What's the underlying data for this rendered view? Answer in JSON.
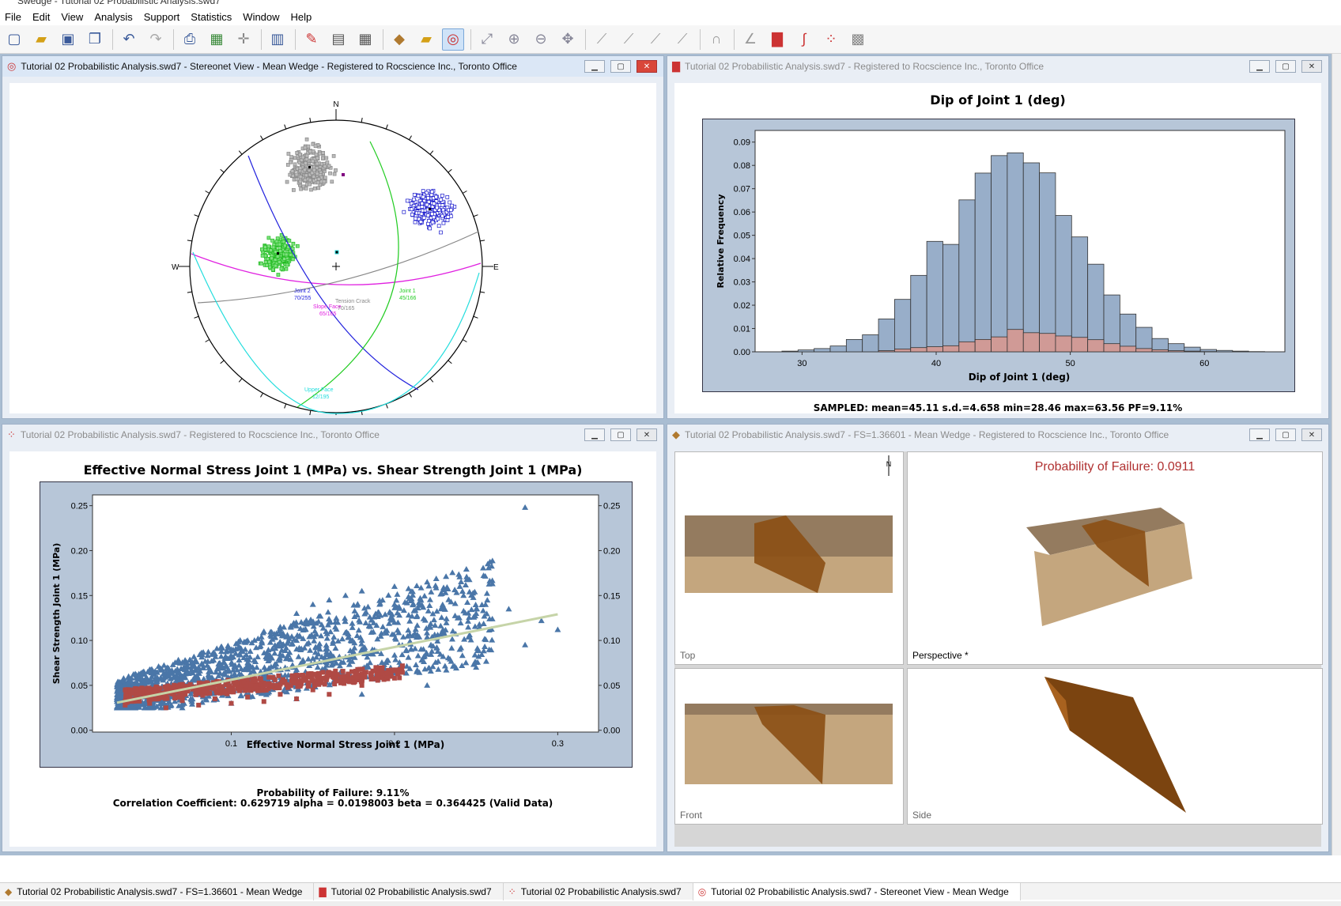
{
  "app": {
    "title": "Swedge - Tutorial 02 Probabilistic Analysis.swd7"
  },
  "menu": [
    "File",
    "Edit",
    "View",
    "Analysis",
    "Support",
    "Statistics",
    "Window",
    "Help"
  ],
  "toolbar_icons": [
    "new-file-icon",
    "open-folder-icon",
    "save-icon",
    "copy-icon",
    "undo-icon",
    "redo-icon",
    "print-icon",
    "grid-icon",
    "add-icon",
    "panel-icon",
    "pen-icon",
    "sheet-icon",
    "calculator-icon",
    "wedge-icon",
    "folder-icon",
    "stereonet-icon",
    "fit-icon",
    "zoom-in-icon",
    "zoom-out-icon",
    "pan-icon",
    "tool-a-icon",
    "tool-b-icon",
    "tool-c-icon",
    "tool-d-icon",
    "magnet-icon",
    "axes-icon",
    "histogram-icon",
    "cumulative-icon",
    "scatter-icon",
    "excel-icon"
  ],
  "windows": {
    "stereonet": {
      "title": "Tutorial 02 Probabilistic Analysis.swd7 - Stereonet View - Mean Wedge - Registered to Rocscience Inc., Toronto Office",
      "compass": {
        "n": "N",
        "s": "S",
        "e": "E",
        "w": "W"
      },
      "labels": {
        "joint2": "Joint 2",
        "joint2_val": "70/255",
        "joint1": "Joint 1",
        "joint1_val": "45/166",
        "tension": "Tension Crack",
        "tension_val": "70/165",
        "slope": "Slope Face",
        "slope_val": "65/165",
        "upper": "Upper Face",
        "upper_val": "12/195"
      },
      "colors": {
        "joint1": "#22cc22",
        "joint2": "#2222dd",
        "slope": "#e020e0",
        "upper": "#22dddd",
        "tension": "#888888"
      }
    },
    "histogram": {
      "title": "Tutorial 02 Probabilistic Analysis.swd7 - Registered to Rocscience Inc., Toronto Office",
      "info": "SAMPLED: mean=45.11 s.d.=4.658 min=28.46 max=63.56 PF=9.11%"
    },
    "scatter": {
      "title": "Tutorial 02 Probabilistic Analysis.swd7 - Registered to Rocscience Inc., Toronto Office",
      "info1": "Probability of Failure: 9.11%",
      "info2": "Correlation Coefficient: 0.629719 alpha = 0.0198003 beta = 0.364425 (Valid Data)"
    },
    "wedge3d": {
      "title": "Tutorial 02 Probabilistic Analysis.swd7 - FS=1.36601 - Mean Wedge - Registered to Rocscience Inc., Toronto Office",
      "pf_label": "Probability of Failure: 0.0911",
      "north": "N",
      "panes": {
        "top": "Top",
        "perspective": "Perspective *",
        "front": "Front",
        "side": "Side"
      }
    }
  },
  "chart_data": [
    {
      "type": "bar",
      "title": "Dip of Joint 1 (deg)",
      "xlabel": "Dip of Joint 1 (deg)",
      "ylabel": "Relative Frequency",
      "xlim": [
        26.5,
        66
      ],
      "ylim": [
        0,
        0.095
      ],
      "xticks": [
        30,
        40,
        50,
        60
      ],
      "yticks": [
        0.0,
        0.01,
        0.02,
        0.03,
        0.04,
        0.05,
        0.06,
        0.07,
        0.08,
        0.09
      ],
      "bin_edges": [
        28.5,
        29.7,
        30.9,
        32.1,
        33.3,
        34.5,
        35.7,
        36.9,
        38.1,
        39.3,
        40.5,
        41.7,
        42.9,
        44.1,
        45.3,
        46.5,
        47.7,
        48.9,
        50.1,
        51.3,
        52.5,
        53.7,
        54.9,
        56.1,
        57.3,
        58.5,
        59.7,
        60.9,
        62.1,
        63.3,
        64.5
      ],
      "series": [
        {
          "name": "All",
          "values": [
            0.0003,
            0.0008,
            0.0014,
            0.0025,
            0.0053,
            0.0073,
            0.0141,
            0.0225,
            0.0328,
            0.0474,
            0.0461,
            0.0652,
            0.0767,
            0.0842,
            0.0854,
            0.0811,
            0.0768,
            0.0585,
            0.0493,
            0.0376,
            0.0244,
            0.0162,
            0.0105,
            0.0057,
            0.0035,
            0.002,
            0.001,
            0.0006,
            0.0003,
            0.0001
          ],
          "color": "#98aec9"
        },
        {
          "name": "Failed",
          "values": [
            0,
            0,
            0,
            0,
            0,
            0,
            0.0005,
            0.0012,
            0.0018,
            0.0022,
            0.0026,
            0.0043,
            0.0053,
            0.0064,
            0.0096,
            0.0082,
            0.0079,
            0.0068,
            0.0062,
            0.0052,
            0.0035,
            0.0024,
            0.0014,
            0.0009,
            0.0005,
            0.0003,
            0.0001,
            0,
            0,
            0
          ],
          "color": "#d09a96"
        }
      ]
    },
    {
      "type": "scatter",
      "title": "Effective Normal Stress Joint 1 (MPa) vs. Shear Strength Joint 1 (MPa)",
      "xlabel": "Effective Normal Stress Joint 1 (MPa)",
      "ylabel": "Shear Strength Joint 1 (MPa)",
      "xlim": [
        0.015,
        0.325
      ],
      "ylim": [
        -0.002,
        0.262
      ],
      "xticks": [
        0.1,
        0.2,
        0.3
      ],
      "yticks": [
        0.0,
        0.05,
        0.1,
        0.15,
        0.2,
        0.25
      ],
      "fit_line": {
        "x": [
          0.03,
          0.3
        ],
        "y": [
          0.0307,
          0.1291
        ],
        "color": "#c6d4a8"
      },
      "series": [
        {
          "name": "Safe",
          "color": "#4a76a8",
          "marker": "triangle",
          "points": [
            [
              0.03,
              0.032
            ],
            [
              0.05,
              0.038
            ],
            [
              0.06,
              0.05
            ],
            [
              0.07,
              0.06
            ],
            [
              0.08,
              0.07
            ],
            [
              0.09,
              0.085
            ],
            [
              0.1,
              0.09
            ],
            [
              0.11,
              0.1
            ],
            [
              0.12,
              0.11
            ],
            [
              0.13,
              0.115
            ],
            [
              0.14,
              0.13
            ],
            [
              0.15,
              0.14
            ],
            [
              0.16,
              0.145
            ],
            [
              0.17,
              0.15
            ],
            [
              0.18,
              0.155
            ],
            [
              0.2,
              0.16
            ],
            [
              0.22,
              0.165
            ],
            [
              0.24,
              0.16
            ],
            [
              0.26,
              0.163
            ],
            [
              0.28,
              0.248
            ],
            [
              0.3,
              0.112
            ],
            [
              0.28,
              0.095
            ],
            [
              0.25,
              0.07
            ],
            [
              0.22,
              0.05
            ],
            [
              0.18,
              0.04
            ],
            [
              0.14,
              0.035
            ],
            [
              0.1,
              0.03
            ],
            [
              0.07,
              0.025
            ],
            [
              0.12,
              0.06
            ],
            [
              0.15,
              0.08
            ],
            [
              0.18,
              0.1
            ],
            [
              0.2,
              0.12
            ],
            [
              0.23,
              0.11
            ],
            [
              0.25,
              0.13
            ],
            [
              0.16,
              0.12
            ],
            [
              0.13,
              0.085
            ],
            [
              0.09,
              0.055
            ],
            [
              0.11,
              0.075
            ],
            [
              0.21,
              0.09
            ],
            [
              0.27,
              0.135
            ],
            [
              0.29,
              0.122
            ],
            [
              0.24,
              0.09
            ],
            [
              0.19,
              0.07
            ],
            [
              0.17,
              0.06
            ],
            [
              0.08,
              0.04
            ],
            [
              0.06,
              0.035
            ],
            [
              0.14,
              0.1
            ],
            [
              0.2,
              0.14
            ],
            [
              0.1,
              0.06
            ],
            [
              0.155,
              0.105
            ]
          ]
        },
        {
          "name": "Failed",
          "color": "#b04a45",
          "marker": "square",
          "points": [
            [
              0.035,
              0.028
            ],
            [
              0.05,
              0.03
            ],
            [
              0.07,
              0.033
            ],
            [
              0.09,
              0.035
            ],
            [
              0.11,
              0.037
            ],
            [
              0.13,
              0.04
            ],
            [
              0.15,
              0.045
            ],
            [
              0.17,
              0.055
            ],
            [
              0.19,
              0.06
            ],
            [
              0.08,
              0.028
            ],
            [
              0.1,
              0.03
            ],
            [
              0.12,
              0.032
            ],
            [
              0.14,
              0.035
            ],
            [
              0.16,
              0.04
            ],
            [
              0.06,
              0.025
            ],
            [
              0.18,
              0.05
            ],
            [
              0.2,
              0.058
            ],
            [
              0.105,
              0.044
            ],
            [
              0.125,
              0.05
            ],
            [
              0.165,
              0.062
            ]
          ]
        }
      ]
    }
  ],
  "taskbar": [
    {
      "label": "Tutorial 02 Probabilistic Analysis.swd7 - FS=1.36601 - Mean Wedge",
      "icon": "wedge-icon"
    },
    {
      "label": "Tutorial 02 Probabilistic Analysis.swd7",
      "icon": "histogram-icon"
    },
    {
      "label": "Tutorial 02 Probabilistic Analysis.swd7",
      "icon": "scatter-icon"
    },
    {
      "label": "Tutorial 02 Probabilistic Analysis.swd7 - Stereonet View - Mean Wedge",
      "icon": "stereonet-icon"
    }
  ]
}
